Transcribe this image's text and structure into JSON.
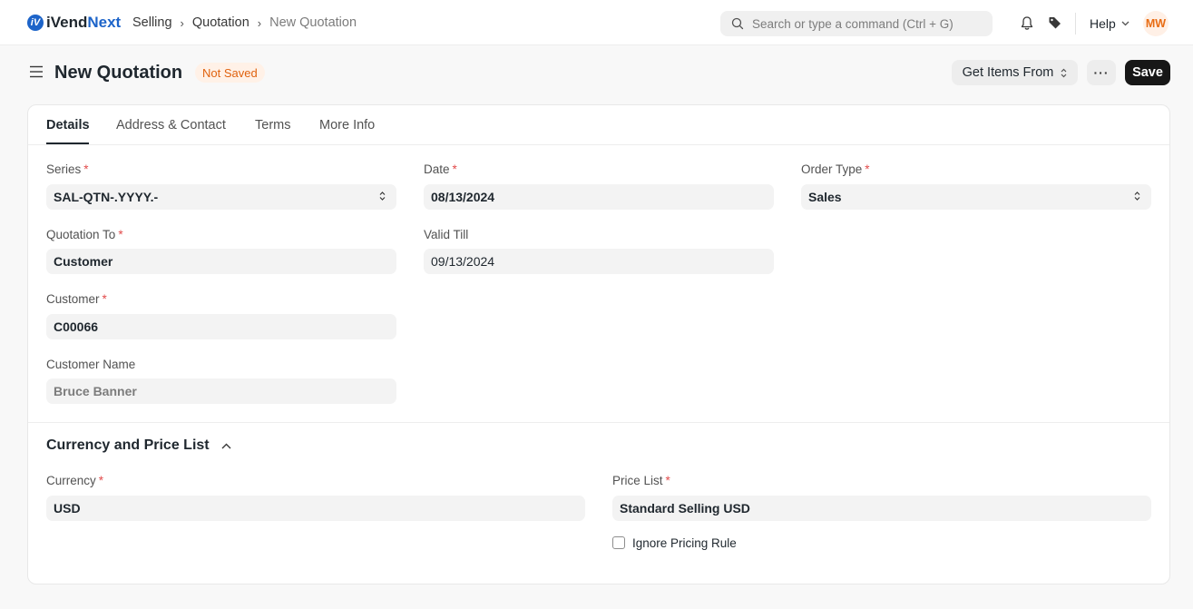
{
  "app": {
    "logo_prefix": "iVend",
    "logo_suffix": "Next",
    "logo_mark": "iV"
  },
  "breadcrumbs": [
    "Selling",
    "Quotation",
    "New Quotation"
  ],
  "search": {
    "placeholder": "Search or type a command (Ctrl + G)"
  },
  "navbar": {
    "help_label": "Help",
    "avatar_initials": "MW"
  },
  "page": {
    "title": "New Quotation",
    "status": "Not Saved",
    "get_items_label": "Get Items From",
    "more_label": "···",
    "save_label": "Save"
  },
  "tabs": [
    {
      "label": "Details",
      "active": true
    },
    {
      "label": "Address & Contact",
      "active": false
    },
    {
      "label": "Terms",
      "active": false
    },
    {
      "label": "More Info",
      "active": false
    }
  ],
  "fields": {
    "series": {
      "label": "Series",
      "value": "SAL-QTN-.YYYY.-",
      "required": true
    },
    "date": {
      "label": "Date",
      "value": "08/13/2024",
      "required": true
    },
    "order_type": {
      "label": "Order Type",
      "value": "Sales",
      "required": true
    },
    "quotation_to": {
      "label": "Quotation To",
      "value": "Customer",
      "required": true
    },
    "valid_till": {
      "label": "Valid Till",
      "value": "09/13/2024",
      "required": false
    },
    "customer": {
      "label": "Customer",
      "value": "C00066",
      "required": true
    },
    "customer_name": {
      "label": "Customer Name",
      "value": "Bruce Banner",
      "required": false
    }
  },
  "currency_section": {
    "title": "Currency and Price List",
    "currency": {
      "label": "Currency",
      "value": "USD",
      "required": true
    },
    "price_list": {
      "label": "Price List",
      "value": "Standard Selling USD",
      "required": true
    },
    "ignore_pricing_rule": {
      "label": "Ignore Pricing Rule",
      "checked": false
    }
  },
  "colors": {
    "brand": "#1d64c9",
    "required": "#e24c4c",
    "status_bg": "#fff1e7",
    "status_text": "#e0620f",
    "primary_button": "#171717"
  },
  "icons": [
    "search-icon",
    "bell-icon",
    "tag-icon",
    "chevron-down-icon",
    "hamburger-icon",
    "updown-icon",
    "chevron-up-icon"
  ]
}
